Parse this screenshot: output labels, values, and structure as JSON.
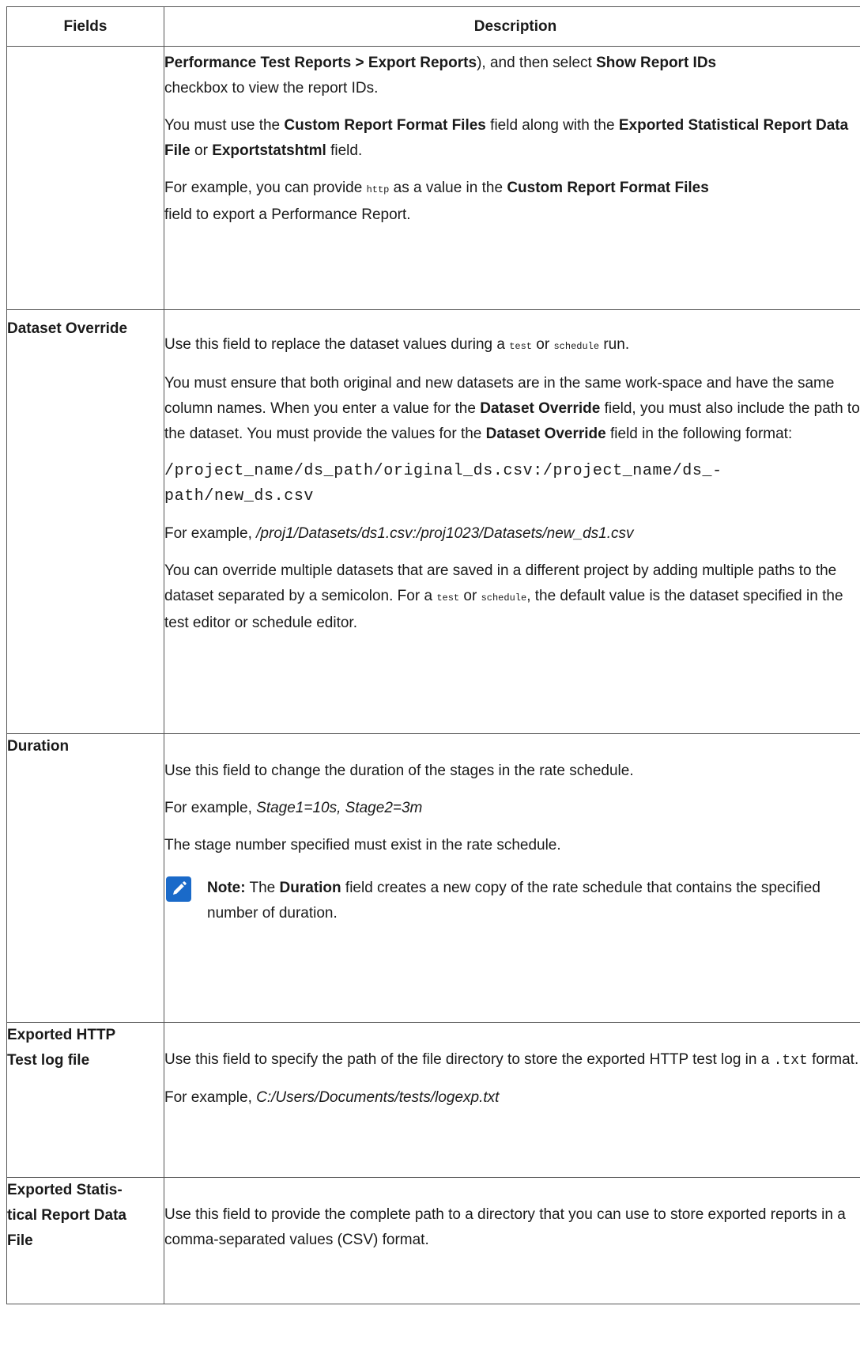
{
  "table": {
    "headers": {
      "fields": "Fields",
      "description": "Description"
    },
    "row0": {
      "p1": {
        "a_b": "Performance Test Reports > Export Reports",
        "b": "), and then select ",
        "c_b": "Show Report IDs",
        "d": "checkbox to view the report IDs."
      },
      "p2": {
        "a": "You must use the ",
        "b_b": "Custom Report Format Files",
        "c": " field along with the ",
        "d_b": "Exported Statistical Report Data File",
        "e": " or ",
        "f_b": "Exportstatshtml",
        "g": " field."
      },
      "p3": {
        "a": "For example, you can provide ",
        "code": "http",
        "b": " as a value in the ",
        "c_b": "Custom Report Format Files",
        "d": "field to export a Performance Report."
      }
    },
    "row1": {
      "field": "Dataset Override",
      "p1": {
        "a": "Use this field to replace the dataset values during a ",
        "code1": "test",
        "b": " or ",
        "code2": "schedule",
        "c": " run."
      },
      "p2": {
        "a": "You must ensure that both original and new datasets are in the same work-space and have the same column names. When you enter a value for the ",
        "b_b": "Dataset Override",
        "c": " field, you must also include the path to the dataset. You must provide the values for the ",
        "d_b": "Dataset Override",
        "e": " field in the following format:"
      },
      "p3_line1": "/project_name/ds_path/original_ds.csv:/project_name/ds_-",
      "p3_line2": "path/new_ds.csv",
      "p4": {
        "a": "For example, ",
        "i": "/proj1/Datasets/ds1.csv:/proj1023/Datasets/new_ds1.csv"
      },
      "p5": {
        "a": "You can override multiple datasets that are saved in a different project by adding multiple paths to the dataset separated by a semicolon. For a ",
        "code1": "test",
        "b": " or ",
        "code2": "schedule",
        "c": ", the default value is the dataset specified in the test editor or schedule editor."
      }
    },
    "row2": {
      "field": "Duration",
      "p1": "Use this field to change the duration of the stages in the rate schedule.",
      "p2": {
        "a": "For example, ",
        "i": "Stage1=10s, Stage2=3m"
      },
      "p3": "The stage number specified must exist in the rate schedule.",
      "note": {
        "icon": "pencil-icon",
        "label": "Note:",
        "a": " The ",
        "b_b": "Duration",
        "c": " field creates a new copy of the rate schedule that contains the specified number of duration."
      }
    },
    "row3": {
      "field_line1": "Exported HTTP",
      "field_line2": "Test log file",
      "p1": {
        "a": "Use this field to specify the path of the file directory to store the exported HTTP test log in a ",
        "code": ".txt",
        "b": " format."
      },
      "p2": {
        "a": "For example, ",
        "i": "C:/Users/Documents/tests/logexp.txt"
      }
    },
    "row4": {
      "field_line1": "Exported Statis-",
      "field_line2": "tical Report Data",
      "field_line3": "File",
      "p1": "Use this field to provide the complete path to a directory that you can use to store exported reports in a comma-separated values (CSV) format."
    },
    "colors": {
      "note_icon": "#1a6ac9",
      "border": "#555555"
    }
  }
}
